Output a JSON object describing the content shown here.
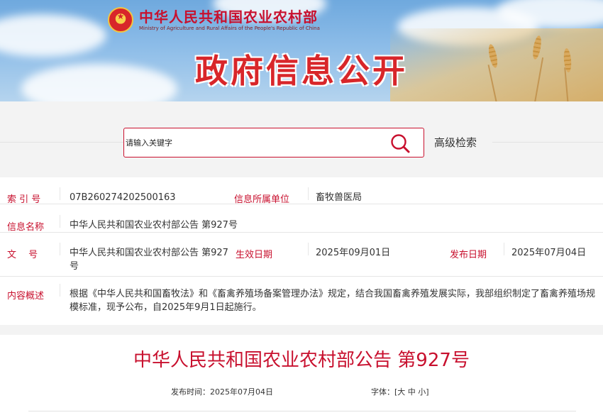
{
  "header": {
    "ministry_cn": "中华人民共和国农业农村部",
    "ministry_en": "Ministry of Agriculture and Rural Affairs of the People's Republic of China",
    "banner_title": "政府信息公开"
  },
  "search": {
    "placeholder": "请输入关键字",
    "advanced_label": "高级检索",
    "icon": "search-icon"
  },
  "info": {
    "index_label": "索 引 号",
    "index_value": "07B260274202500163",
    "unit_label": "信息所属单位",
    "unit_value": "畜牧兽医局",
    "name_label": "信息名称",
    "name_value": "中华人民共和国农业农村部公告 第927号",
    "doc_label": "文　 号",
    "doc_value": "中华人民共和国农业农村部公告 第927号",
    "effective_label": "生效日期",
    "effective_value": "2025年09月01日",
    "publish_label": "发布日期",
    "publish_value": "2025年07月04日",
    "summary_label": "内容概述",
    "summary_value": "根据《中华人民共和国畜牧法》和《畜禽养殖场备案管理办法》规定，结合我国畜禽养殖发展实际，我部组织制定了畜禽养殖场规模标准，现予公布，自2025年9月1日起施行。"
  },
  "article": {
    "title": "中华人民共和国农业农村部公告 第927号",
    "publish_time_label": "发布时间：",
    "publish_time_value": "2025年07月04日",
    "font_label": "字体：",
    "font_open": "[",
    "font_large": "大",
    "font_medium": "中",
    "font_small": "小",
    "font_close": "]"
  },
  "colors": {
    "accent": "#c8102e",
    "banner_sky": "#7fb3e3"
  }
}
